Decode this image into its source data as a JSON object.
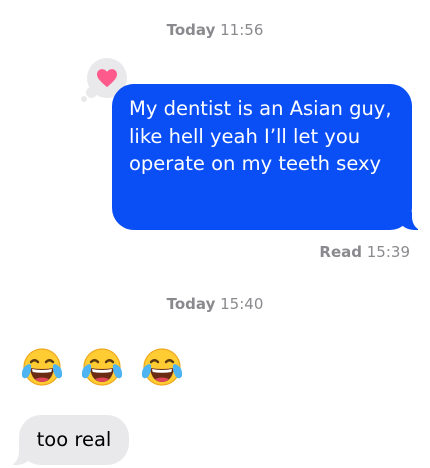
{
  "thread": {
    "timestamp_1": {
      "day": "Today",
      "time": "11:56"
    },
    "outgoing_message": {
      "text": "My dentist is an Asian guy, like hell yeah I’ll let you operate on my teeth sexy",
      "bubble_color": "#0a4ef5",
      "reaction_icon": "heart-icon",
      "reaction_color": "#ff5a8c"
    },
    "read_receipt": {
      "status": "Read",
      "time": "15:39"
    },
    "timestamp_2": {
      "day": "Today",
      "time": "15:40"
    },
    "emoji_message": {
      "emojis": [
        "face-with-tears-of-joy-icon",
        "face-with-tears-of-joy-icon",
        "face-with-tears-of-joy-icon"
      ]
    },
    "incoming_message": {
      "text": "too real",
      "bubble_color": "#e9e9eb"
    }
  }
}
